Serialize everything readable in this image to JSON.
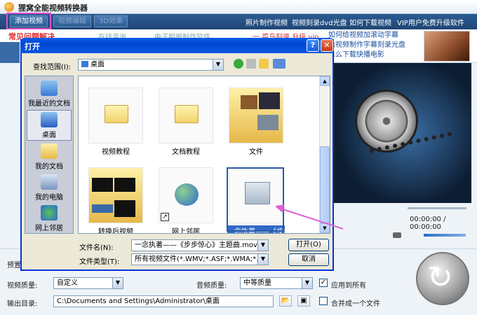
{
  "app": {
    "title": "狸窝全能视频转换器",
    "toolbar": {
      "add_video": "添加视频",
      "edit_video": "视频编辑",
      "effect_3d": "3D效果",
      "links": [
        "照片制作视频",
        "视频刻录dvd光盘",
        "如何下载视频",
        "VIP用户免费升级软件"
      ]
    },
    "banner": {
      "faq": "常见问题解决",
      "faded_1": "在线咨询",
      "faded_2": "电子相册制作软件",
      "faded_3": "一 菜鸟刻录 升级 vip",
      "ad_links": [
        "如何给视频加滚动字幕",
        "给视频制作字幕刻录光盘",
        "怎么下载快播电影"
      ]
    },
    "preview": {
      "time": "00:00:00 / 00:00:00"
    },
    "bottom": {
      "preset_label": "预置",
      "video_quality_label": "视频质量:",
      "video_quality_value": "自定义",
      "audio_quality_label": "音频质量:",
      "audio_quality_value": "中等质量",
      "apply_all": "应用到所有",
      "output_label": "输出目录:",
      "output_path": "C:\\Documents and Settings\\Administrator\\桌面",
      "merge_label": "合并成一个文件"
    }
  },
  "dialog": {
    "title": "打开",
    "lookin_label": "查找范围(I):",
    "lookin_value": "桌面",
    "places": [
      {
        "label": "我最近的文档"
      },
      {
        "label": "桌面"
      },
      {
        "label": "我的文档"
      },
      {
        "label": "我的电脑"
      },
      {
        "label": "网上邻居"
      }
    ],
    "files": [
      {
        "name": "视频教程"
      },
      {
        "name": "文档教程"
      },
      {
        "name": "文件"
      },
      {
        "name": "转换后视频"
      },
      {
        "name": "网上邻居"
      },
      {
        "name": "一念执著——《步步惊"
      }
    ],
    "filename_label": "文件名(N):",
    "filename_value": "一念执著——《步步惊心》主题曲.mov",
    "filetype_label": "文件类型(T):",
    "filetype_value": "所有视频文件(*.WMV;*.ASF;*.WMA;*.AVI;",
    "open_btn": "打开(O)",
    "cancel_btn": "取消"
  },
  "colors": {
    "accent": "#0831d9",
    "highlight": "#e04fd0",
    "selection": "#316ac5"
  }
}
